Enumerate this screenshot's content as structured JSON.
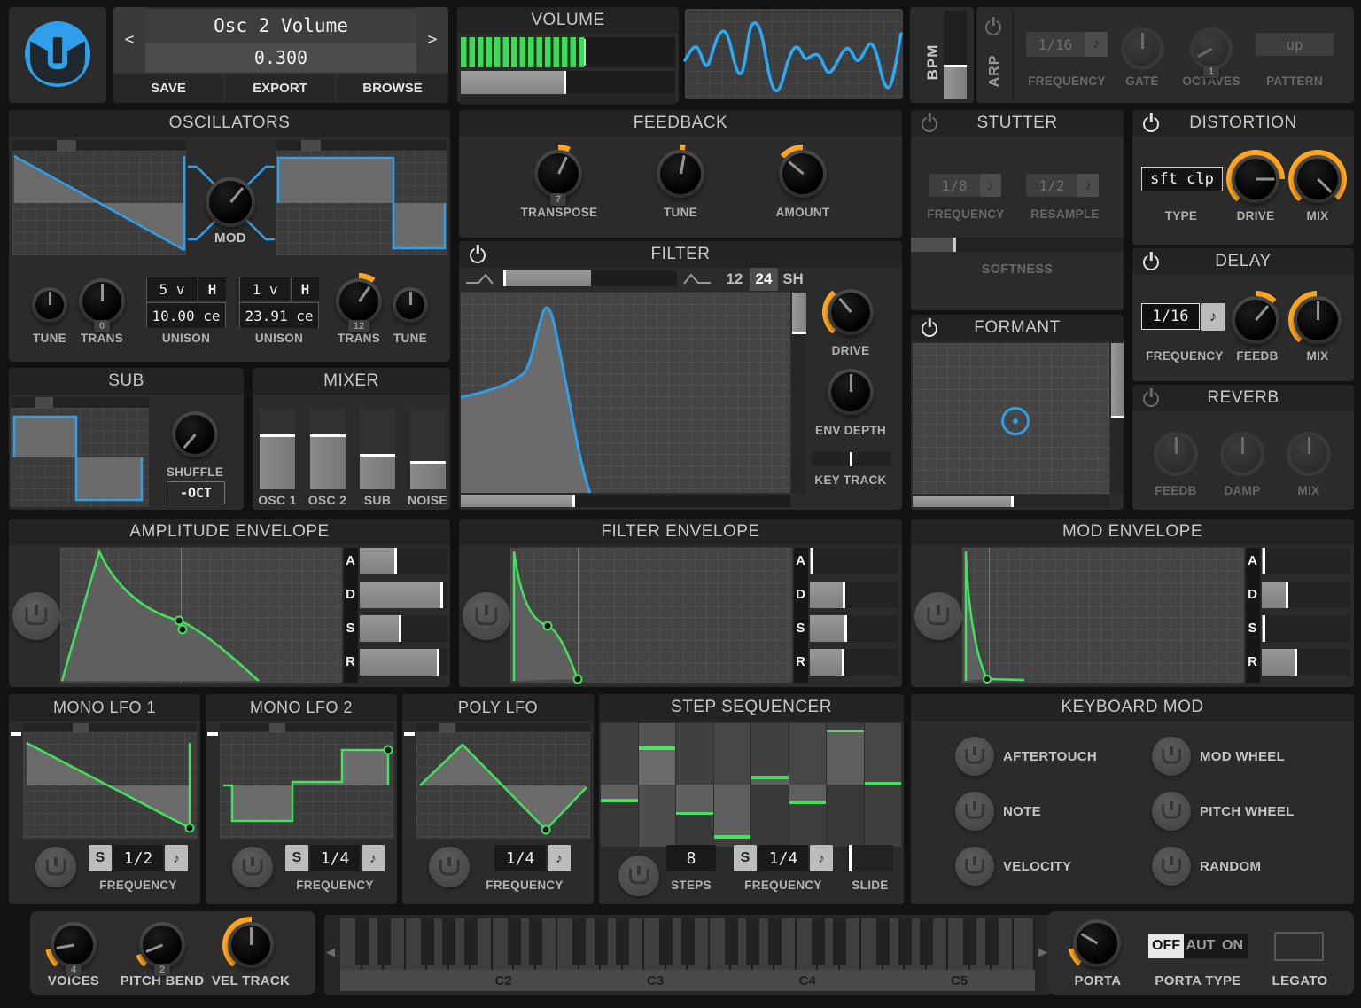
{
  "header": {
    "patch": {
      "prev": "<",
      "next": ">",
      "name": "Osc 2 Volume",
      "value": "0.300",
      "save": "SAVE",
      "export": "EXPORT",
      "browse": "BROWSE"
    },
    "volume_title": "VOLUME",
    "bpm_label": "BPM",
    "arp": {
      "label": "ARP",
      "frequency_value": "1/16",
      "frequency_label": "FREQUENCY",
      "gate_label": "GATE",
      "octaves_label": "OCTAVES",
      "octaves_value": "1",
      "pattern_value": "up",
      "pattern_label": "PATTERN"
    }
  },
  "oscillators": {
    "title": "OSCILLATORS",
    "mod_label": "MOD",
    "tune_label": "TUNE",
    "trans_label": "TRANS",
    "osc1_trans_value": "0",
    "osc2_trans_value": "12",
    "unison_label": "UNISON",
    "harmonize": "H",
    "osc1_unison_voices": "5 v",
    "osc1_unison_cents": "10.00 ce",
    "osc2_unison_voices": "1 v",
    "osc2_unison_cents": "23.91 ce"
  },
  "sub": {
    "title": "SUB",
    "shuffle_label": "SHUFFLE",
    "octave_button": "-OCT"
  },
  "mixer": {
    "title": "MIXER",
    "channels": [
      {
        "label": "OSC 1",
        "level": 64
      },
      {
        "label": "OSC 2",
        "level": 64
      },
      {
        "label": "SUB",
        "level": 40
      },
      {
        "label": "NOISE",
        "level": 32
      }
    ]
  },
  "feedback": {
    "title": "FEEDBACK",
    "transpose_label": "TRANSPOSE",
    "transpose_value": "7",
    "tune_label": "TUNE",
    "amount_label": "AMOUNT"
  },
  "filter": {
    "title": "FILTER",
    "mode_12": "12",
    "mode_24": "24",
    "mode_shelf": "SH",
    "drive_label": "DRIVE",
    "env_depth_label": "ENV DEPTH",
    "key_track_label": "KEY TRACK"
  },
  "stutter": {
    "title": "STUTTER",
    "frequency_value": "1/8",
    "frequency_label": "FREQUENCY",
    "resample_value": "1/2",
    "resample_label": "RESAMPLE",
    "softness_label": "SOFTNESS"
  },
  "formant": {
    "title": "FORMANT"
  },
  "distortion": {
    "title": "DISTORTION",
    "type_value": "sft clp",
    "type_label": "TYPE",
    "drive_label": "DRIVE",
    "mix_label": "MIX"
  },
  "delay": {
    "title": "DELAY",
    "frequency_value": "1/16",
    "frequency_label": "FREQUENCY",
    "feedback_label": "FEEDB",
    "mix_label": "MIX"
  },
  "reverb": {
    "title": "REVERB",
    "feedback_label": "FEEDB",
    "damp_label": "DAMP",
    "mix_label": "MIX"
  },
  "envelopes": [
    {
      "title": "AMPLITUDE ENVELOPE",
      "adsr": [
        {
          "letter": "A",
          "value": 40
        },
        {
          "letter": "D",
          "value": 92
        },
        {
          "letter": "S",
          "value": 45
        },
        {
          "letter": "R",
          "value": 88
        }
      ]
    },
    {
      "title": "FILTER ENVELOPE",
      "adsr": [
        {
          "letter": "A",
          "value": 2
        },
        {
          "letter": "D",
          "value": 38
        },
        {
          "letter": "S",
          "value": 40
        },
        {
          "letter": "R",
          "value": 37
        }
      ]
    },
    {
      "title": "MOD ENVELOPE",
      "adsr": [
        {
          "letter": "A",
          "value": 2
        },
        {
          "letter": "D",
          "value": 28
        },
        {
          "letter": "S",
          "value": 2
        },
        {
          "letter": "R",
          "value": 38
        }
      ]
    }
  ],
  "lfo1": {
    "title": "MONO LFO 1",
    "sync": "S",
    "frequency_value": "1/2",
    "frequency_label": "FREQUENCY"
  },
  "lfo2": {
    "title": "MONO LFO 2",
    "sync": "S",
    "frequency_value": "1/4",
    "frequency_label": "FREQUENCY"
  },
  "poly_lfo": {
    "title": "POLY LFO",
    "frequency_value": "1/4",
    "frequency_label": "FREQUENCY"
  },
  "step_sequencer": {
    "title": "STEP SEQUENCER",
    "steps_value": "8",
    "steps_label": "STEPS",
    "sync": "S",
    "frequency_value": "1/4",
    "frequency_label": "FREQUENCY",
    "slide_label": "SLIDE",
    "values": [
      -0.3,
      0.65,
      -0.52,
      -0.92,
      0.15,
      -0.33,
      0.94,
      0.05
    ],
    "active_step": 1
  },
  "keyboard_mod": {
    "title": "KEYBOARD MOD",
    "sources": [
      "AFTERTOUCH",
      "MOD WHEEL",
      "NOTE",
      "PITCH WHEEL",
      "VELOCITY",
      "RANDOM"
    ]
  },
  "bottom": {
    "voices_label": "VOICES",
    "voices_value": "4",
    "pitch_bend_label": "PITCH BEND",
    "pitch_bend_value": "2",
    "vel_track_label": "VEL TRACK",
    "porta_label": "PORTA",
    "porta_type_label": "PORTA TYPE",
    "porta_off": "OFF",
    "porta_aut": "AUT",
    "porta_on": "ON",
    "legato_label": "LEGATO"
  },
  "keyboard": {
    "octave_labels": [
      "C2",
      "C3",
      "C4",
      "C5"
    ],
    "scroll_left": "◀",
    "scroll_right": "▶"
  },
  "glyphs": {
    "note": "♪"
  },
  "colors": {
    "accent_blue": "#2e9fe8",
    "accent_green": "#43e25c",
    "accent_orange": "#ffa520",
    "meter_green": "#41d95a"
  }
}
